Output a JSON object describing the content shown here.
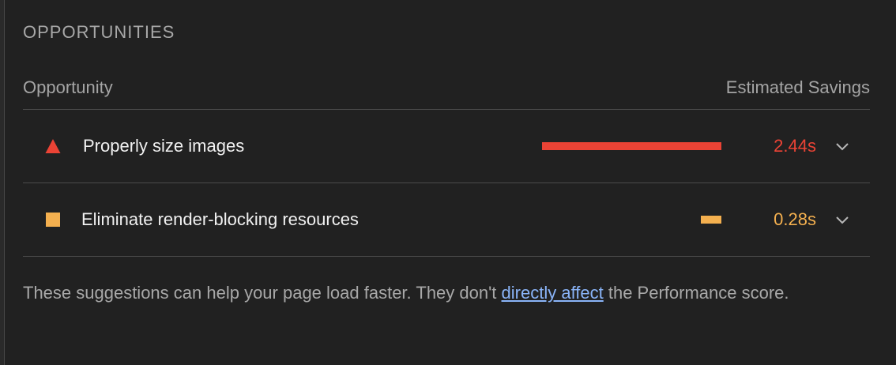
{
  "section": {
    "title": "OPPORTUNITIES"
  },
  "table_header": {
    "opportunity_label": "Opportunity",
    "savings_label": "Estimated Savings"
  },
  "colors": {
    "fail": "#eb4335",
    "average": "#f4b04f",
    "link": "#8ab4f8"
  },
  "max_savings_seconds": 2.44,
  "audits": [
    {
      "title": "Properly size images",
      "savings_text": "2.44s",
      "savings_seconds": 2.44,
      "rating": "fail",
      "icon": "red-triangle-icon",
      "color": "#eb4335"
    },
    {
      "title": "Eliminate render-blocking resources",
      "savings_text": "0.28s",
      "savings_seconds": 0.28,
      "rating": "average",
      "icon": "orange-square-icon",
      "color": "#f4b04f"
    }
  ],
  "footnote": {
    "before": "These suggestions can help your page load faster. They don't ",
    "link_text": "directly affect",
    "after": " the Performance score."
  }
}
